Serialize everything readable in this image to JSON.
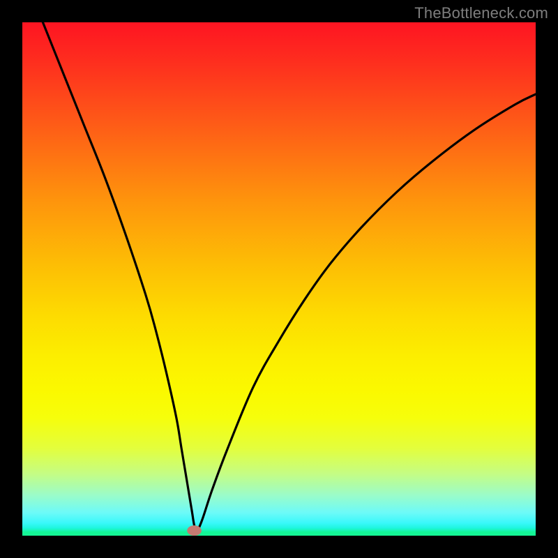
{
  "watermark": "TheBottleneck.com",
  "colors": {
    "frame": "#000000",
    "curve": "#000000",
    "marker": "#c47a72"
  },
  "chart_data": {
    "type": "line",
    "title": "",
    "xlabel": "",
    "ylabel": "",
    "xlim": [
      0,
      100
    ],
    "ylim": [
      0,
      100
    ],
    "grid": false,
    "legend": false,
    "background": "rainbow-vertical-gradient (red top → green bottom)",
    "series": [
      {
        "name": "bottleneck-curve",
        "x": [
          4,
          8,
          12,
          16,
          20,
          24,
          26,
          28,
          30,
          31,
          32,
          33,
          33.5,
          34,
          35,
          37,
          40,
          45,
          50,
          55,
          60,
          66,
          73,
          80,
          88,
          96,
          100
        ],
        "values": [
          100,
          90,
          80,
          70,
          59,
          47,
          40,
          32,
          23,
          17,
          11,
          5,
          2,
          1,
          3,
          9,
          17,
          29,
          38,
          46,
          53,
          60,
          67,
          73,
          79,
          84,
          86
        ]
      }
    ],
    "marker": {
      "x": 33.5,
      "y": 1,
      "rx": 1.4,
      "ry": 1.0
    }
  }
}
